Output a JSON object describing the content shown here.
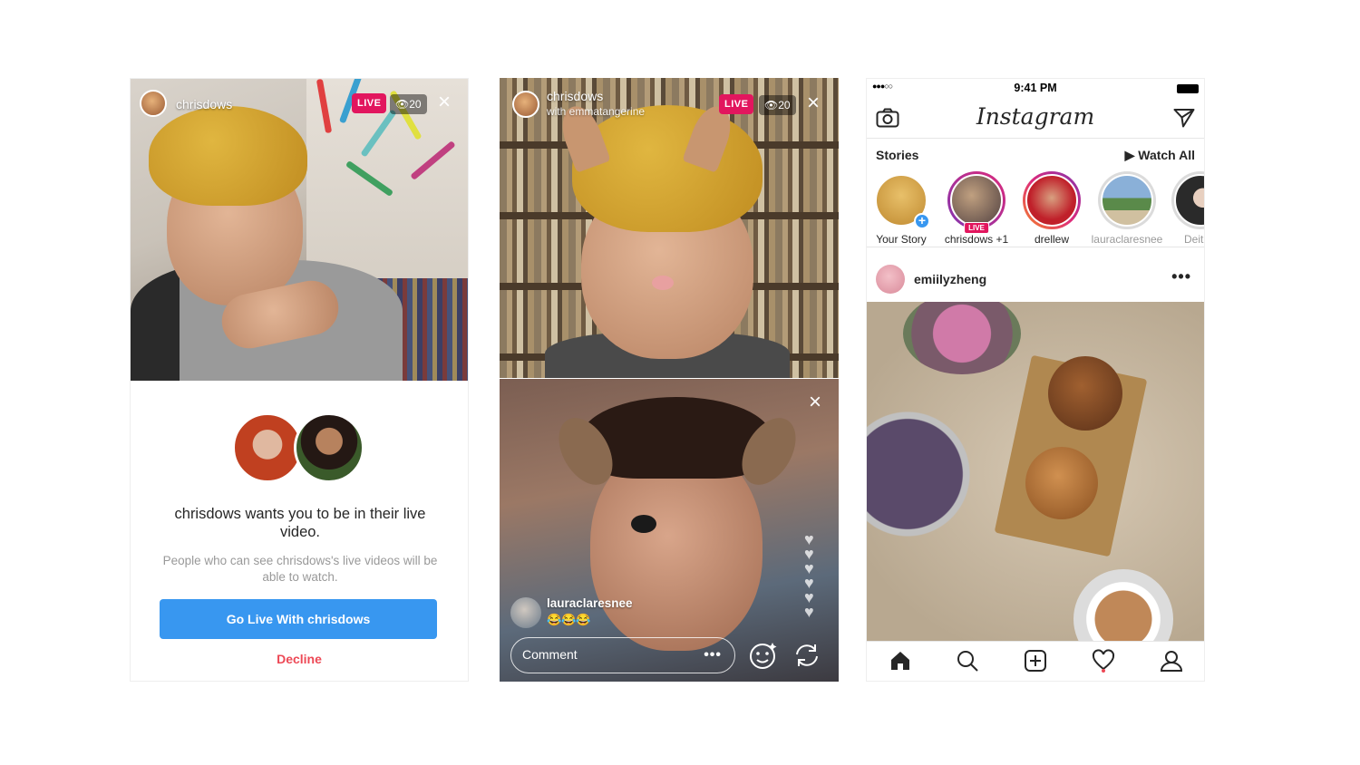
{
  "phone1": {
    "username": "chrisdows",
    "live_label": "LIVE",
    "viewers": "20",
    "invite_title": "chrisdows wants you to be in their live video.",
    "invite_subtitle": "People who can see chrisdows's live videos will be able to watch.",
    "go_live_button": "Go Live With chrisdows",
    "decline_button": "Decline"
  },
  "phone2": {
    "host_username": "chrisdows",
    "with_label": "with emmatangerine",
    "live_label": "LIVE",
    "viewers": "20",
    "commenter": "lauraclaresnee",
    "comment_text": "😂😂😂",
    "comment_placeholder": "Comment",
    "comment_more": "•••"
  },
  "phone3": {
    "status": {
      "signal": "●●●○○",
      "time": "9:41 PM"
    },
    "logo": "Instagram",
    "stories_title": "Stories",
    "watch_all": "▶ Watch All",
    "stories": [
      {
        "label": "Your Story"
      },
      {
        "label": "chrisdows +1",
        "badge": "LIVE"
      },
      {
        "label": "drellew"
      },
      {
        "label": "lauraclaresnee"
      },
      {
        "label": "Deit"
      }
    ],
    "post_user": "emiilyzheng",
    "post_more": "•••"
  },
  "colors": {
    "live": "#e2165e",
    "button_blue": "#3897f0",
    "decline_red": "#ed4956"
  },
  "icons": [
    "camera-icon",
    "direct-send-icon",
    "home-icon",
    "search-icon",
    "add-post-icon",
    "heart-icon",
    "profile-icon",
    "close-icon",
    "face-filter-icon",
    "flip-camera-icon"
  ]
}
